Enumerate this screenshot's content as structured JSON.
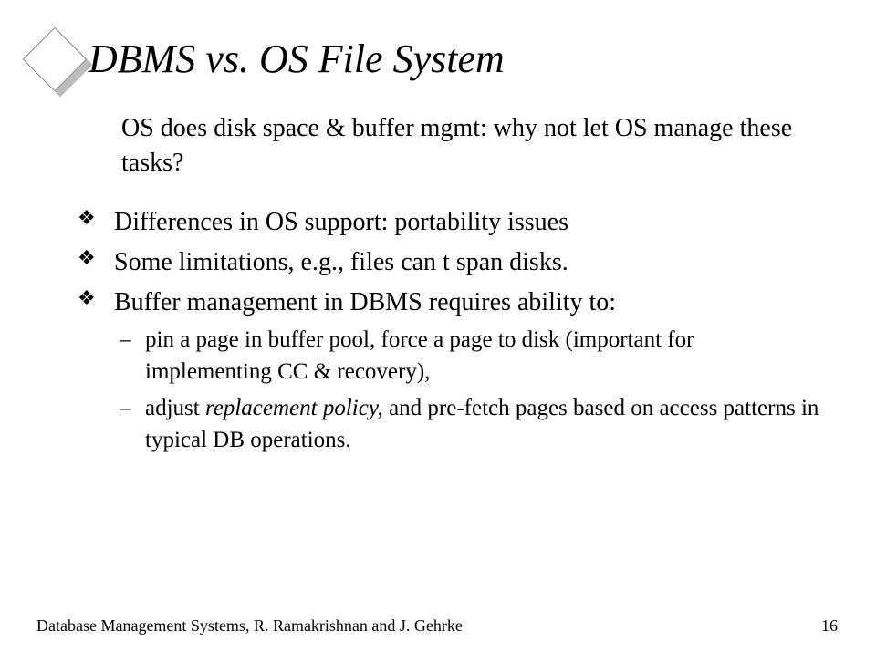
{
  "title": "DBMS vs. OS File System",
  "subtitle": "OS does disk space & buffer mgmt: why not let OS manage these tasks?",
  "bullets": {
    "b1": "Differences in OS support: portability issues",
    "b2": "Some limitations, e.g., files can t span disks.",
    "b3": "Buffer management in DBMS requires ability to:",
    "b3a_pre": "pin a page in buffer pool, force a page to disk (important for implementing CC & recovery),",
    "b3b_pre": "adjust ",
    "b3b_ital": "replacement policy,",
    "b3b_post": " and pre-fetch pages based on access patterns in typical DB operations."
  },
  "footer": "Database Management Systems, R. Ramakrishnan and J. Gehrke",
  "page": "16"
}
